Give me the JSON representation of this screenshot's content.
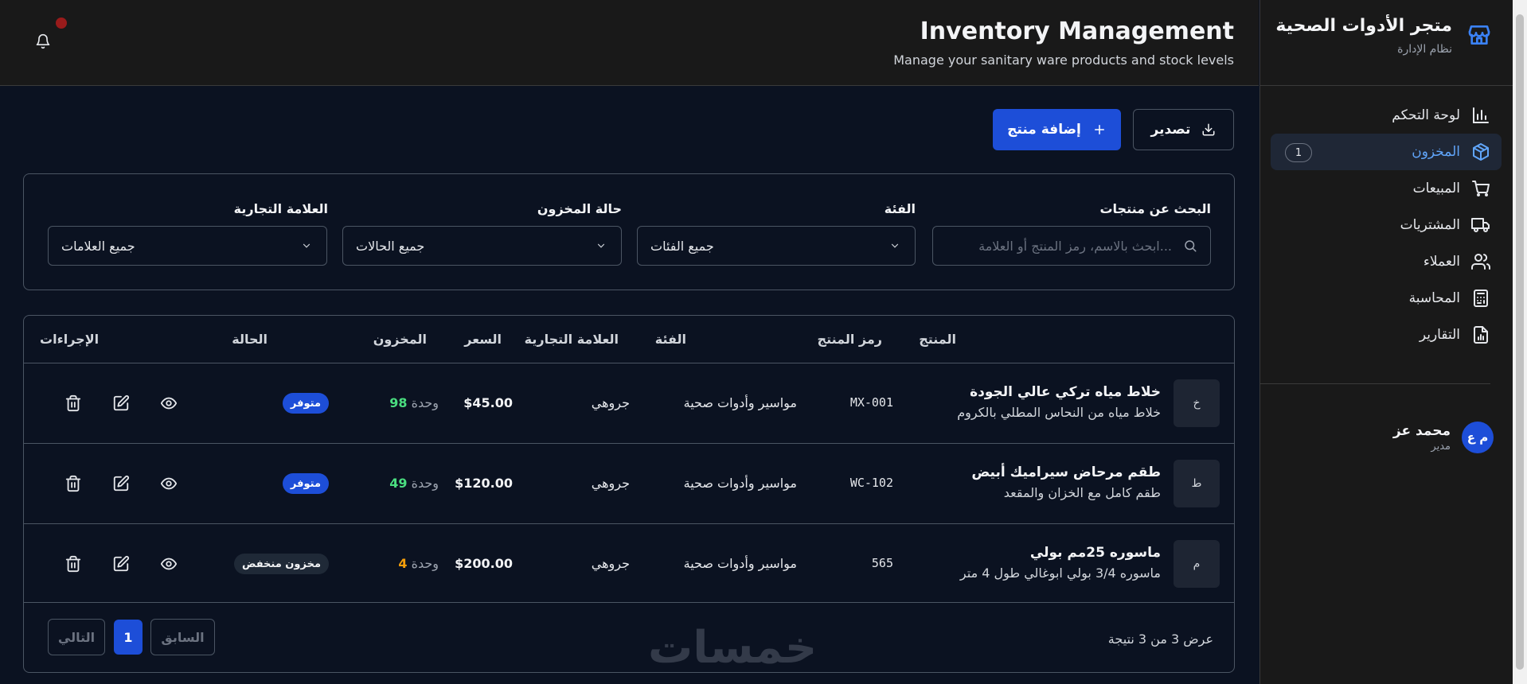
{
  "sidebar": {
    "title": "متجر الأدوات الصحية",
    "subtitle": "نظام الإدارة",
    "items": [
      {
        "label": "لوحة التحكم",
        "icon": "chart-bar-icon"
      },
      {
        "label": "المخزون",
        "icon": "package-icon",
        "badge": "1",
        "active": true
      },
      {
        "label": "المبيعات",
        "icon": "cart-icon"
      },
      {
        "label": "المشتريات",
        "icon": "truck-icon"
      },
      {
        "label": "العملاء",
        "icon": "users-icon"
      },
      {
        "label": "المحاسبة",
        "icon": "calculator-icon"
      },
      {
        "label": "التقارير",
        "icon": "report-icon"
      }
    ],
    "user": {
      "initials": "م ع",
      "name": "محمد عز",
      "role": "مدير"
    }
  },
  "header": {
    "title": "Inventory Management",
    "subtitle": "Manage your sanitary ware products and stock levels"
  },
  "actions": {
    "export_label": "تصدير",
    "add_label": "إضافة منتج"
  },
  "filters": {
    "search_label": "البحث عن منتجات",
    "search_placeholder": "ابحث بالاسم، رمز المنتج أو العلامة...",
    "category_label": "الفئة",
    "category_value": "جميع الفئات",
    "stock_label": "حالة المخزون",
    "stock_value": "جميع الحالات",
    "brand_label": "العلامة التجارية",
    "brand_value": "جميع العلامات"
  },
  "table": {
    "headers": {
      "product": "المنتج",
      "sku": "رمز المنتج",
      "category": "الفئة",
      "brand": "العلامة التجارية",
      "price": "السعر",
      "stock": "المخزون",
      "status": "الحالة",
      "actions": "الإجراءات"
    },
    "rows": [
      {
        "letter": "خ",
        "name": "خلاط مياه تركي عالي الجودة",
        "desc": "خلاط مياه من النحاس المطلي بالكروم",
        "sku": "MX-001",
        "category": "مواسير وأدوات صحية",
        "brand": "جروهي",
        "price": "$45.00",
        "stock": "98",
        "unit": "وحدة",
        "status": "متوفر",
        "status_type": "ok"
      },
      {
        "letter": "ط",
        "name": "طقم مرحاض سيراميك أبيض",
        "desc": "طقم كامل مع الخزان والمقعد",
        "sku": "WC-102",
        "category": "مواسير وأدوات صحية",
        "brand": "جروهي",
        "price": "$120.00",
        "stock": "49",
        "unit": "وحدة",
        "status": "متوفر",
        "status_type": "ok"
      },
      {
        "letter": "م",
        "name": "ماسوره 25مم بولي",
        "desc": "ماسوره 3/4 بولي ابوغالي طول 4 متر",
        "sku": "565",
        "category": "مواسير وأدوات صحية",
        "brand": "جروهي",
        "price": "$200.00",
        "stock": "4",
        "unit": "وحدة",
        "status": "مخزون منخفض",
        "status_type": "low"
      }
    ],
    "result_text": "عرض 3 من 3 نتيجة",
    "prev_label": "السابق",
    "next_label": "التالي",
    "current_page": "1"
  },
  "watermark": "خمسات",
  "colors": {
    "accent": "#1d4ed8",
    "ok_stock": "#4ade80",
    "low_stock": "#f59e0b",
    "notification": "#991b1b"
  }
}
